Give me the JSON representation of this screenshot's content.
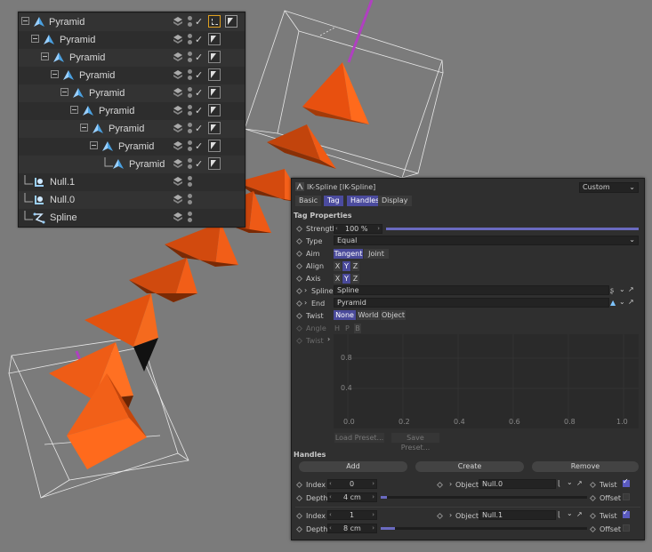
{
  "object_manager": {
    "rows": [
      {
        "name": "Pyramid",
        "type": "pyramid",
        "tag": "ik-tag"
      },
      {
        "name": "Pyramid",
        "type": "pyramid",
        "tag": "phong"
      },
      {
        "name": "Pyramid",
        "type": "pyramid",
        "tag": "phong"
      },
      {
        "name": "Pyramid",
        "type": "pyramid",
        "tag": "phong"
      },
      {
        "name": "Pyramid",
        "type": "pyramid",
        "tag": "phong"
      },
      {
        "name": "Pyramid",
        "type": "pyramid",
        "tag": "phong"
      },
      {
        "name": "Pyramid",
        "type": "pyramid",
        "tag": "phong"
      },
      {
        "name": "Pyramid",
        "type": "pyramid",
        "tag": "phong"
      },
      {
        "name": "Pyramid",
        "type": "pyramid",
        "tag": "phong"
      },
      {
        "name": "Null.1",
        "type": "null",
        "tag": ""
      },
      {
        "name": "Null.0",
        "type": "null",
        "tag": ""
      },
      {
        "name": "Spline",
        "type": "spline",
        "tag": ""
      }
    ]
  },
  "attributes": {
    "title": "IK-Spline [IK-Spline]",
    "mode": "Custom",
    "tabs": [
      "Basic",
      "Tag",
      "Handles",
      "Display"
    ],
    "section_title": "Tag Properties",
    "strength_label": "Strength",
    "strength_value": "100 %",
    "strength_fraction": 1.0,
    "type_label": "Type",
    "type_value": "Equal",
    "aim_label": "Aim",
    "aim_options": [
      "Tangent",
      "Joint"
    ],
    "align_label": "Align",
    "axis_label": "Axis",
    "xyz": [
      "X",
      "Y",
      "Z"
    ],
    "spline_label": "Spline",
    "spline_value": "Spline",
    "end_label": "End",
    "end_value": "Pyramid",
    "twist_label": "Twist",
    "twist_options": [
      "None",
      "World",
      "Object"
    ],
    "angle_label": "Angle",
    "hpb": [
      "H",
      "P",
      "B"
    ],
    "twist_curve_label": "Twist",
    "graph_y": [
      "0.8",
      "0.4"
    ],
    "graph_x": [
      "0.0",
      "0.2",
      "0.4",
      "0.6",
      "0.8",
      "1.0"
    ],
    "load_preset": "Load Preset...",
    "save_preset": "Save Preset...",
    "handles_title": "Handles",
    "add_label": "Add",
    "create_label": "Create",
    "remove_label": "Remove",
    "handles": [
      {
        "index_label": "Index",
        "index": "0",
        "depth_label": "Depth",
        "depth": "4 cm",
        "depth_fraction": 0.03,
        "object_label": "Object",
        "object": "Null.0",
        "twist_label": "Twist",
        "twist_checked": true,
        "offset_label": "Offset",
        "offset_checked": false
      },
      {
        "index_label": "Index",
        "index": "1",
        "depth_label": "Depth",
        "depth": "8 cm",
        "depth_fraction": 0.07,
        "object_label": "Object",
        "object": "Null.1",
        "twist_label": "Twist",
        "twist_checked": true,
        "offset_label": "Offset",
        "offset_checked": false
      }
    ]
  },
  "colors": {
    "pyramid": "#f05a14",
    "accent": "#4b4b9e",
    "background": "#7b7b7b"
  }
}
